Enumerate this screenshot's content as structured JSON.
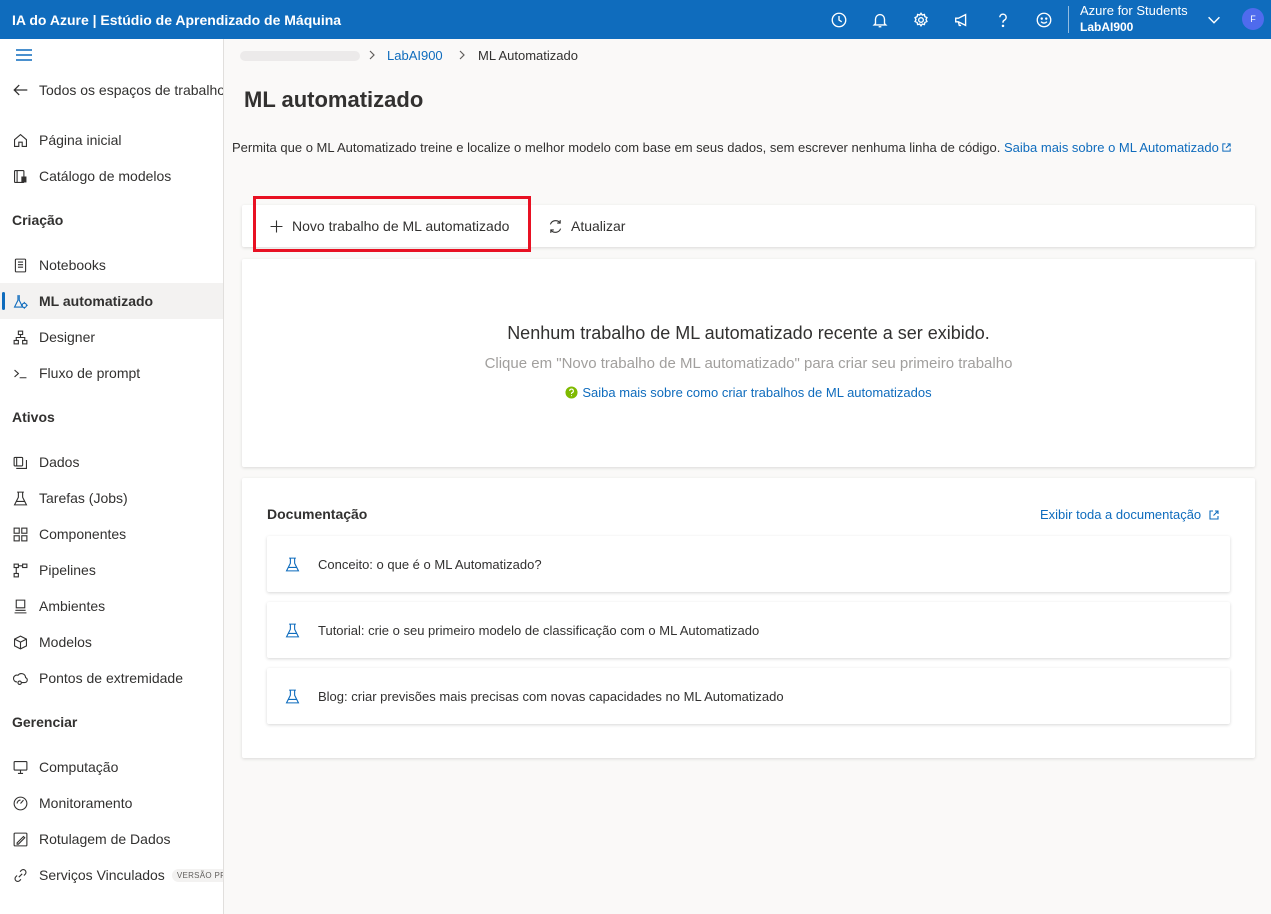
{
  "header": {
    "title": "IA do Azure | Estúdio de Aprendizado de Máquina",
    "icons": [
      "clock-icon",
      "bell-icon",
      "gear-icon",
      "megaphone-icon",
      "help-icon",
      "smiley-icon"
    ],
    "subscription": "Azure for Students",
    "workspace": "LabAI900",
    "avatar_initial": "F"
  },
  "sidebar": {
    "back_label": "Todos os espaços de trabalho",
    "top_items": [
      {
        "label": "Página inicial",
        "icon": "home-icon"
      },
      {
        "label": "Catálogo de modelos",
        "icon": "catalog-icon"
      }
    ],
    "sections": [
      {
        "title": "Criação",
        "items": [
          {
            "label": "Notebooks",
            "icon": "notebook-icon"
          },
          {
            "label": "ML automatizado",
            "icon": "automl-icon",
            "active": true
          },
          {
            "label": "Designer",
            "icon": "designer-icon"
          },
          {
            "label": "Fluxo de prompt",
            "icon": "prompt-icon"
          }
        ]
      },
      {
        "title": "Ativos",
        "items": [
          {
            "label": "Dados",
            "icon": "data-icon"
          },
          {
            "label": "Tarefas (Jobs)",
            "icon": "flask-icon"
          },
          {
            "label": "Componentes",
            "icon": "components-icon"
          },
          {
            "label": "Pipelines",
            "icon": "pipelines-icon"
          },
          {
            "label": "Ambientes",
            "icon": "environments-icon"
          },
          {
            "label": "Modelos",
            "icon": "cube-icon"
          },
          {
            "label": "Pontos de extremidade",
            "icon": "endpoints-icon"
          }
        ]
      },
      {
        "title": "Gerenciar",
        "items": [
          {
            "label": "Computação",
            "icon": "compute-icon"
          },
          {
            "label": "Monitoramento",
            "icon": "monitor-icon"
          },
          {
            "label": "Rotulagem de Dados",
            "icon": "labeling-icon"
          },
          {
            "label": "Serviços Vinculados",
            "icon": "linked-icon",
            "badge": "VERSÃO PRÉVIA"
          }
        ]
      }
    ]
  },
  "breadcrumb": {
    "workspace": "LabAI900",
    "current": "ML Automatizado"
  },
  "page": {
    "title": "ML automatizado",
    "description": "Permita que o ML Automatizado treine e localize o melhor modelo com base em seus dados, sem escrever nenhuma linha de código.",
    "learn_more_link": "Saiba mais sobre o ML Automatizado"
  },
  "toolbar": {
    "new_job": "Novo trabalho de ML automatizado",
    "refresh": "Atualizar"
  },
  "empty_state": {
    "title": "Nenhum trabalho de ML automatizado recente a ser exibido.",
    "subtitle": "Clique em \"Novo trabalho de ML automatizado\" para criar seu primeiro trabalho",
    "link": "Saiba mais sobre como criar trabalhos de ML automatizados"
  },
  "documentation": {
    "title": "Documentação",
    "view_all": "Exibir toda a documentação",
    "items": [
      {
        "label": "Conceito: o que é o ML Automatizado?"
      },
      {
        "label": "Tutorial: crie o seu primeiro modelo de classificação com o ML Automatizado"
      },
      {
        "label": "Blog: criar previsões mais precisas com novas capacidades no ML Automatizado"
      }
    ]
  },
  "colors": {
    "brand": "#0f6cbd",
    "highlight_box": "#e81123",
    "link": "#0f6cbd",
    "help_green": "#7fba00"
  }
}
